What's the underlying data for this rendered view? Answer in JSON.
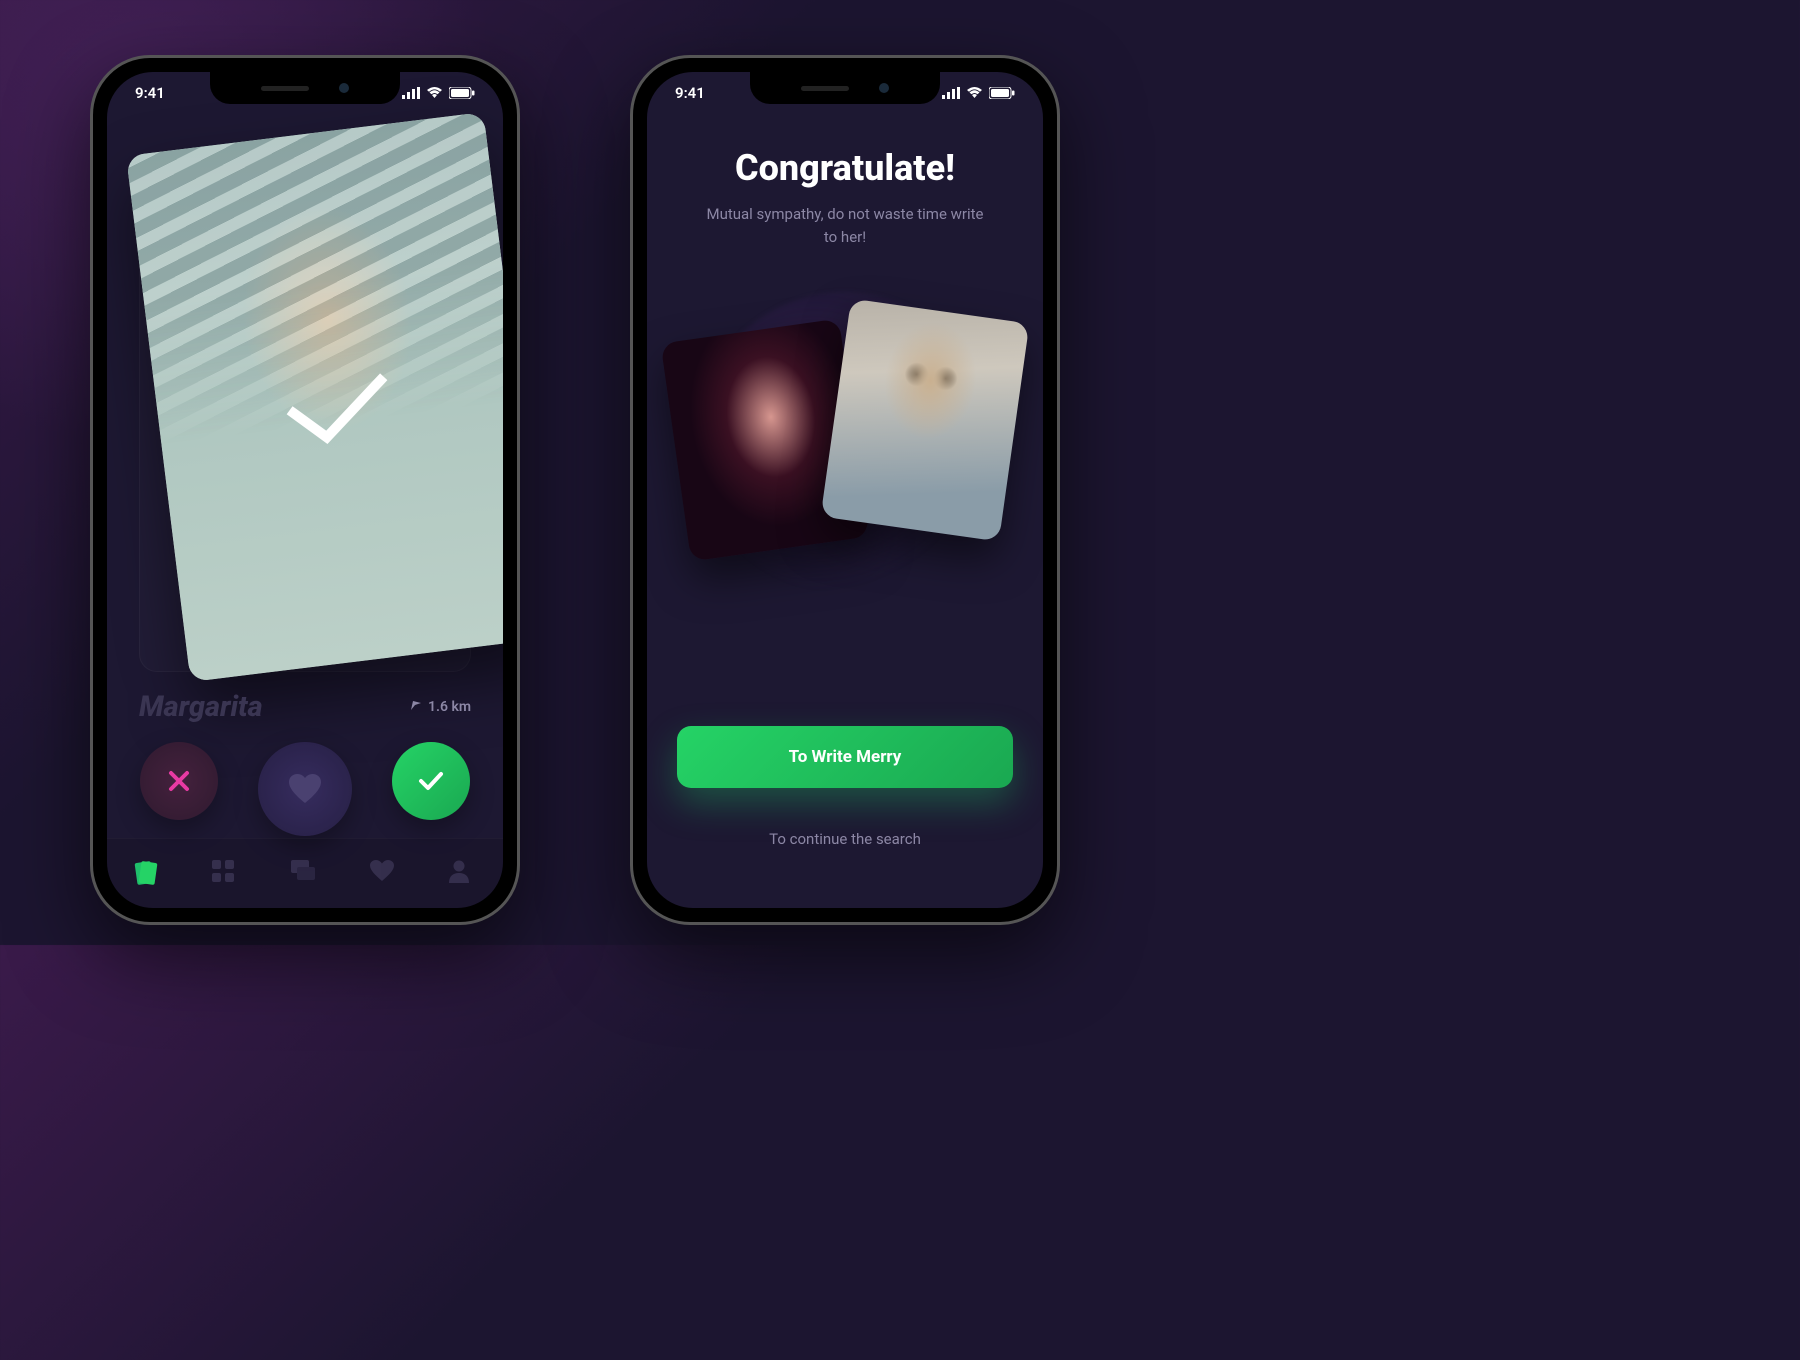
{
  "status": {
    "time": "9:41"
  },
  "swipe": {
    "name": "Margarita",
    "distance": "1.6 km"
  },
  "tabs": [
    "cards",
    "grid",
    "chats",
    "likes",
    "profile"
  ],
  "match": {
    "title": "Congratulate!",
    "subtitle": "Mutual sympathy, do not waste time write to her!",
    "primary_button": "To Write Merry",
    "secondary_link": "To continue the search"
  }
}
